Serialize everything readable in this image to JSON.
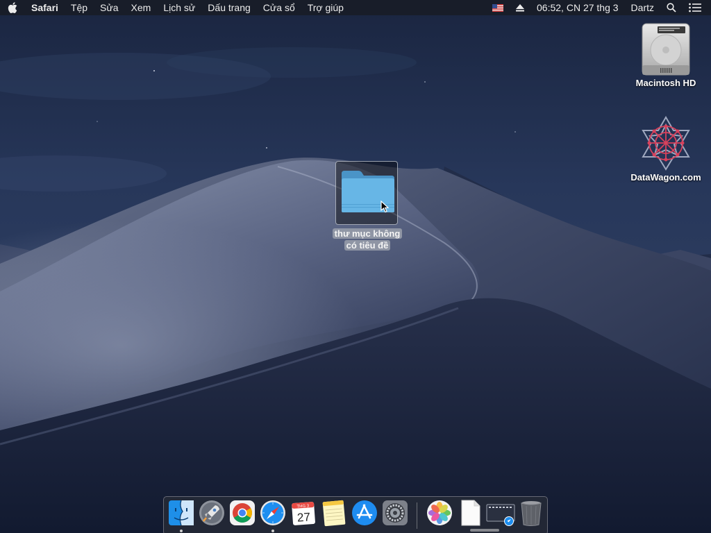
{
  "menubar": {
    "app_name": "Safari",
    "menus": [
      "Tệp",
      "Sửa",
      "Xem",
      "Lịch sử",
      "Dấu trang",
      "Cửa sổ",
      "Trợ giúp"
    ],
    "status": {
      "input_source_icon": "us-flag-icon",
      "eject_icon": "eject-icon",
      "datetime": "06:52, CN 27 thg 3",
      "user": "Dartz",
      "spotlight_icon": "search-icon",
      "notification_icon": "notification-center-icon"
    }
  },
  "desktop": {
    "icons": [
      {
        "name": "Macintosh HD",
        "icon": "hard-drive-icon"
      },
      {
        "name": "DataWagon.com",
        "icon": "datawagon-logo-icon"
      }
    ],
    "folder": {
      "label": "thư mục không có tiêu đề",
      "icon": "folder-icon",
      "selected": true
    }
  },
  "calendar": {
    "month_abbr": "THG 3",
    "day": "27"
  },
  "dock": {
    "apps": [
      {
        "name": "Finder",
        "icon": "finder-icon",
        "running": true
      },
      {
        "name": "Launchpad",
        "icon": "launchpad-icon",
        "running": false
      },
      {
        "name": "Google Chrome",
        "icon": "chrome-icon",
        "running": false
      },
      {
        "name": "Safari",
        "icon": "safari-icon",
        "running": true
      },
      {
        "name": "Calendar",
        "icon": "calendar-icon",
        "running": false
      },
      {
        "name": "Notes",
        "icon": "notes-icon",
        "running": false
      },
      {
        "name": "App Store",
        "icon": "app-store-icon",
        "running": false
      },
      {
        "name": "System Preferences",
        "icon": "system-preferences-icon",
        "running": false
      }
    ],
    "others": [
      {
        "name": "Photos",
        "icon": "photos-icon"
      },
      {
        "name": "Document",
        "icon": "document-icon"
      },
      {
        "name": "Screen Capture",
        "icon": "screenshot-stack-icon"
      },
      {
        "name": "Trash",
        "icon": "trash-icon"
      }
    ]
  },
  "colors": {
    "menubar_bg": "#181c26",
    "folder_blue": "#5fb0e0",
    "sky_top": "#1a2540",
    "dune_highlight": "#8a94ad"
  }
}
